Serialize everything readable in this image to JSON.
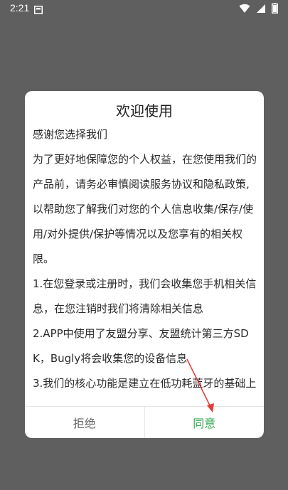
{
  "status_bar": {
    "time": "2:21",
    "icons": [
      "notification-icon",
      "wifi-icon",
      "signal-icon",
      "battery-icon"
    ]
  },
  "dialog": {
    "title": "欢迎使用",
    "paragraphs": [
      "感谢您选择我们",
      "为了更好地保障您的个人权益，在您使用我们的产品前，请务必审慎阅读服务协议和隐私政策,以帮助您了解我们对您的个人信息收集/保存/使用/对外提供/保护等情况以及您享有的相关权限。",
      "1.在您登录或注册时，我们会收集您手机相关信息，在您注销时我们将清除相关信息",
      "2.APP中使用了友盟分享、友盟统计第三方SDK，Bugly将会收集您的设备信息",
      "3.我们的核心功能是建立在低功耗蓝牙的基础上"
    ],
    "reject_label": "拒绝",
    "agree_label": "同意"
  },
  "colors": {
    "backdrop": "#5f5f5f",
    "agree": "#34a853",
    "annotation_arrow": "#e53935"
  }
}
